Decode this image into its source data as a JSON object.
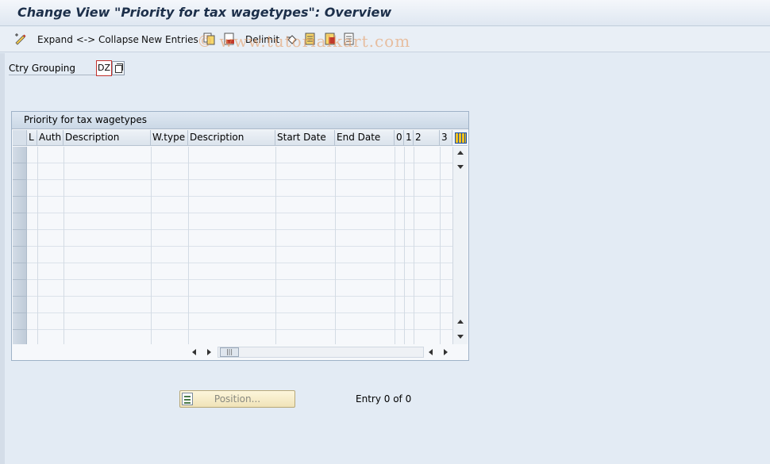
{
  "title": "Change View \"Priority for tax wagetypes\": Overview",
  "toolbar": {
    "expand_collapse": "Expand <-> Collapse",
    "new_entries": "New Entries",
    "delimit": "Delimit"
  },
  "watermark": "© www.tutorialkart.com",
  "field": {
    "label": "Ctry Grouping",
    "value": "DZ"
  },
  "table": {
    "title": "Priority for tax wagetypes",
    "columns": [
      "L",
      "Auth",
      "Description",
      "W.type",
      "Description",
      "Start Date",
      "End Date",
      "0",
      "1",
      "2",
      "3"
    ],
    "row_count": 12
  },
  "position_button": "Position...",
  "entry_status": "Entry 0 of 0"
}
